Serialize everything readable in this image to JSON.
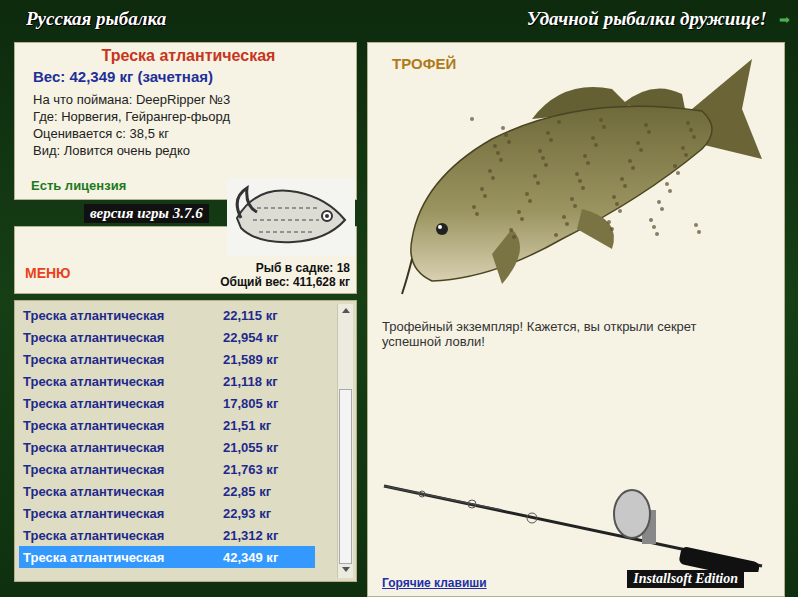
{
  "header": {
    "title": "Русская рыбалка",
    "slogan": "Удачной рыбалки дружище!",
    "exit_icon": "➡"
  },
  "catch": {
    "name": "Треска атлантическая",
    "weight": "Вес: 42,349 кг (зачетная)",
    "details": [
      "На что поймана: DeepRipper №3",
      "Где: Норвегия, Гейрангер-фьорд",
      "Оценивается с: 38,5 кг",
      "Вид: Ловится очень редко"
    ],
    "license": "Есть лицензия"
  },
  "version": "версия игры 3.7.6",
  "menu": "МЕНЮ",
  "keepnet": {
    "count": "Рыб в садке: 18",
    "total": "Общий вес: 411,628 кг"
  },
  "list": {
    "scroll_level": 1,
    "rows": [
      {
        "name": "Треска атлантическая",
        "weight": "22,115 кг",
        "selected": false
      },
      {
        "name": "Треска атлантическая",
        "weight": "22,954 кг",
        "selected": false
      },
      {
        "name": "Треска атлантическая",
        "weight": "21,589 кг",
        "selected": false
      },
      {
        "name": "Треска атлантическая",
        "weight": "21,118 кг",
        "selected": false
      },
      {
        "name": "Треска атлантическая",
        "weight": "17,805 кг",
        "selected": false
      },
      {
        "name": "Треска атлантическая",
        "weight": "21,51 кг",
        "selected": false
      },
      {
        "name": "Треска атлантическая",
        "weight": "21,055 кг",
        "selected": false
      },
      {
        "name": "Треска атлантическая",
        "weight": "21,763 кг",
        "selected": false
      },
      {
        "name": "Треска атлантическая",
        "weight": "22,85 кг",
        "selected": false
      },
      {
        "name": "Треска атлантическая",
        "weight": "22,93 кг",
        "selected": false
      },
      {
        "name": "Треска атлантическая",
        "weight": "21,312 кг",
        "selected": false
      },
      {
        "name": "Треска атлантическая",
        "weight": "42,349 кг",
        "selected": true
      }
    ]
  },
  "trophy": {
    "label": "ТРОФЕЙ",
    "caption": "Трофейный экземпляр! Кажется, вы открыли секрет успешной ловли!",
    "hotkeys": "Горячие клавиши",
    "edition": "Installsoft Edition"
  }
}
